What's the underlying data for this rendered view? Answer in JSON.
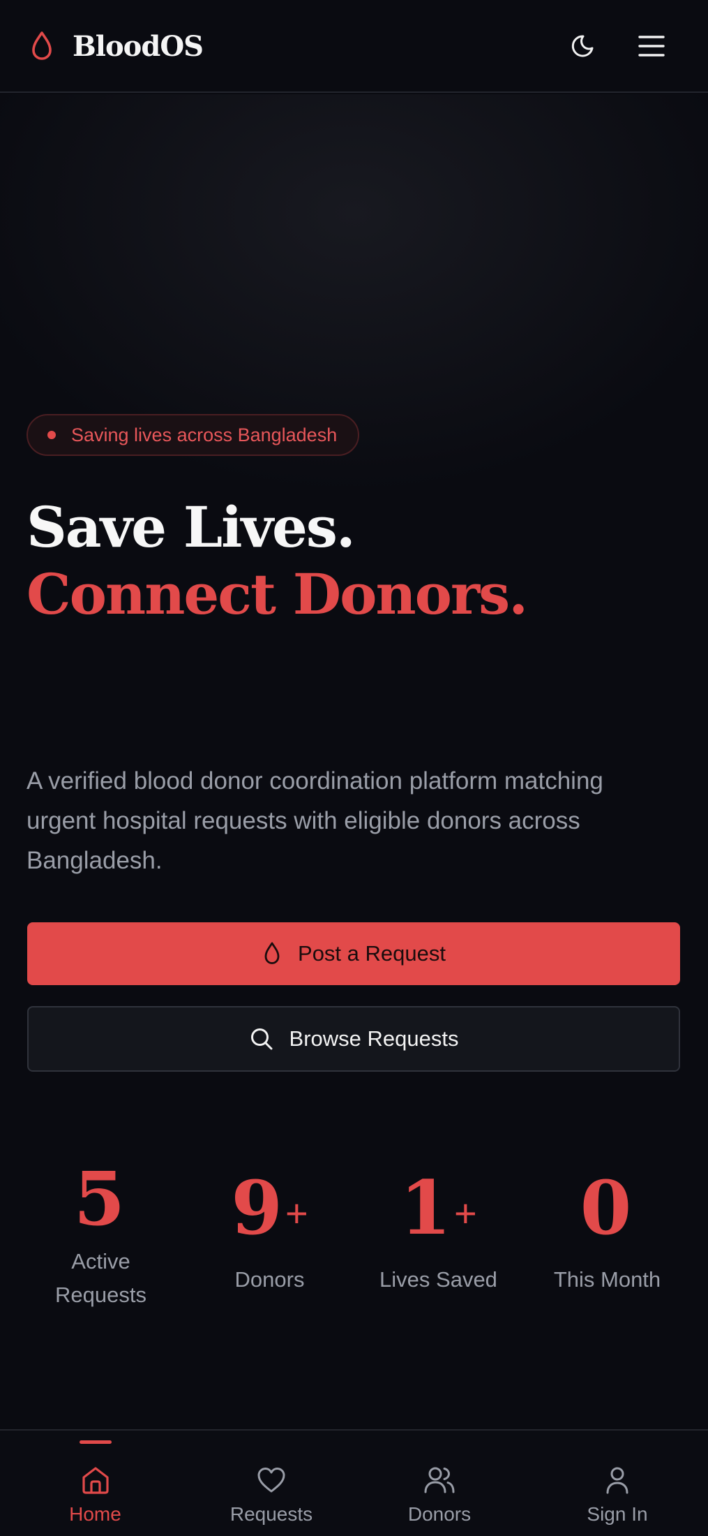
{
  "header": {
    "brand_name": "BloodOS",
    "logo_icon": "blood-drop-icon",
    "theme_toggle_icon": "moon-icon",
    "menu_icon": "hamburger-menu-icon"
  },
  "hero": {
    "badge_text": "Saving lives across Bangladesh",
    "headline_line1": "Save Lives.",
    "headline_line2": "Connect Donors.",
    "description": "A verified blood donor coordination platform matching urgent hospital requests with eligible donors across Bangladesh.",
    "primary_button": {
      "label": "Post a Request",
      "icon": "blood-drop-icon"
    },
    "secondary_button": {
      "label": "Browse Requests",
      "icon": "search-icon"
    }
  },
  "stats": [
    {
      "value": "5",
      "suffix": "",
      "label": "Active Requests"
    },
    {
      "value": "9",
      "suffix": "+",
      "label": "Donors"
    },
    {
      "value": "1",
      "suffix": "+",
      "label": "Lives Saved"
    },
    {
      "value": "0",
      "suffix": "",
      "label": "This Month"
    }
  ],
  "bottom_nav": {
    "active": "Home",
    "items": [
      {
        "label": "Home",
        "icon": "home-icon"
      },
      {
        "label": "Requests",
        "icon": "heart-icon"
      },
      {
        "label": "Donors",
        "icon": "users-icon"
      },
      {
        "label": "Sign In",
        "icon": "user-icon"
      }
    ]
  },
  "colors": {
    "background": "#0a0b11",
    "accent": "#e24a4a",
    "text_primary": "#f5f5f5",
    "text_muted": "#9a9ea8",
    "border": "#23252d"
  }
}
